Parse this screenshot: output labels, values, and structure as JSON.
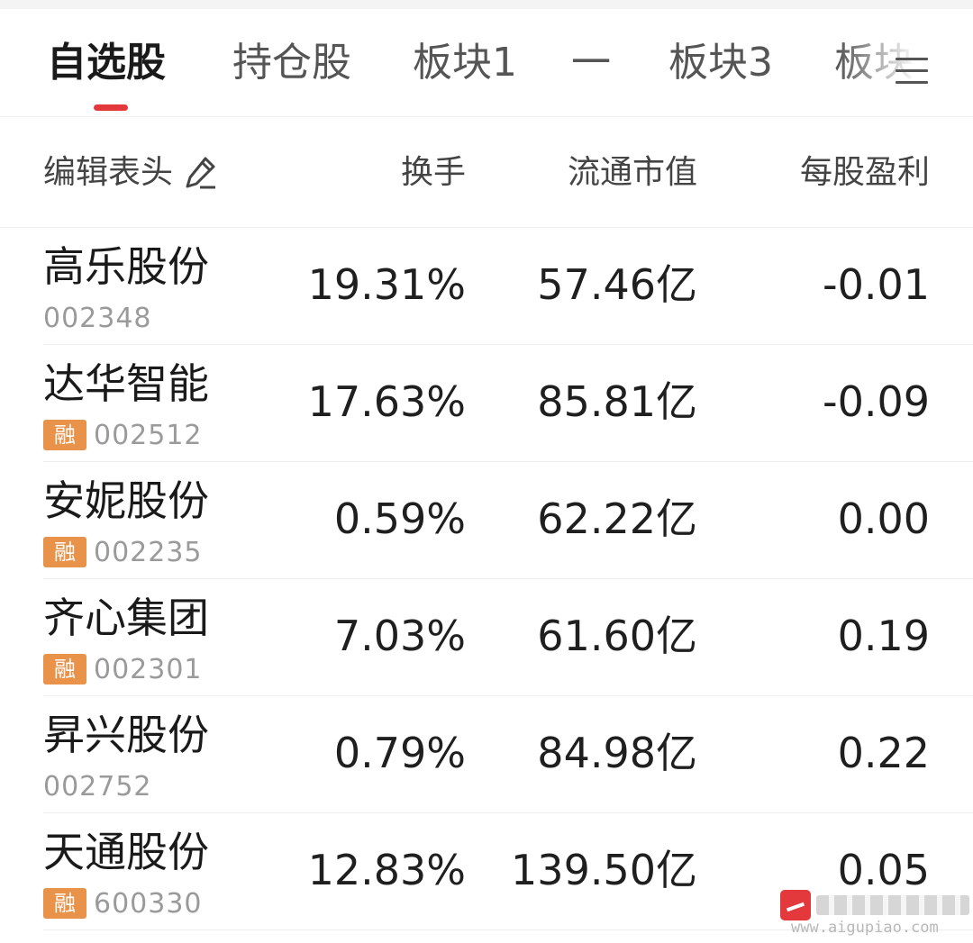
{
  "tabs": [
    {
      "label": "自选股",
      "active": true
    },
    {
      "label": "持仓股",
      "active": false
    },
    {
      "label": "板块1",
      "active": false
    },
    {
      "label": "一",
      "active": false
    },
    {
      "label": "板块3",
      "active": false
    },
    {
      "label": "板块",
      "active": false
    }
  ],
  "colors": {
    "accent": "#e4393c",
    "badge": "#e8924a"
  },
  "header": {
    "edit_label": "编辑表头",
    "edit_icon": "edit-icon",
    "col_turnover": "换手",
    "col_float_cap": "流通市值",
    "col_eps": "每股盈利"
  },
  "stocks": [
    {
      "name": "高乐股份",
      "code": "002348",
      "margin": false,
      "badge": "",
      "turnover": "19.31%",
      "float_cap": "57.46亿",
      "eps": "-0.01"
    },
    {
      "name": "达华智能",
      "code": "002512",
      "margin": true,
      "badge": "融",
      "turnover": "17.63%",
      "float_cap": "85.81亿",
      "eps": "-0.09"
    },
    {
      "name": "安妮股份",
      "code": "002235",
      "margin": true,
      "badge": "融",
      "turnover": "0.59%",
      "float_cap": "62.22亿",
      "eps": "0.00"
    },
    {
      "name": "齐心集团",
      "code": "002301",
      "margin": true,
      "badge": "融",
      "turnover": "7.03%",
      "float_cap": "61.60亿",
      "eps": "0.19"
    },
    {
      "name": "昇兴股份",
      "code": "002752",
      "margin": false,
      "badge": "",
      "turnover": "0.79%",
      "float_cap": "84.98亿",
      "eps": "0.22"
    },
    {
      "name": "天通股份",
      "code": "600330",
      "margin": true,
      "badge": "融",
      "turnover": "12.83%",
      "float_cap": "139.50亿",
      "eps": "0.05"
    }
  ],
  "watermark": {
    "url": "www.aigupiao.com"
  }
}
